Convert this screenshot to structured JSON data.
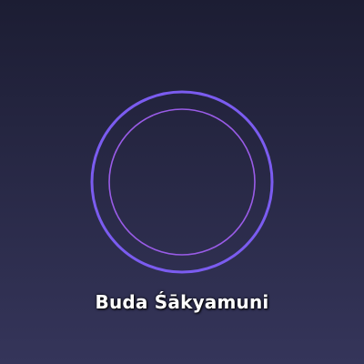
{
  "caption": {
    "text": "Buda Śākyamuni"
  },
  "colors": {
    "background_top": "#1c1d33",
    "background_bottom": "#35355a",
    "outer_ring": "#7b5cf0",
    "inner_ring": "#9a5ce8",
    "caption_text": "#ffffff"
  },
  "icons": {
    "ring": "double-circle-icon"
  }
}
